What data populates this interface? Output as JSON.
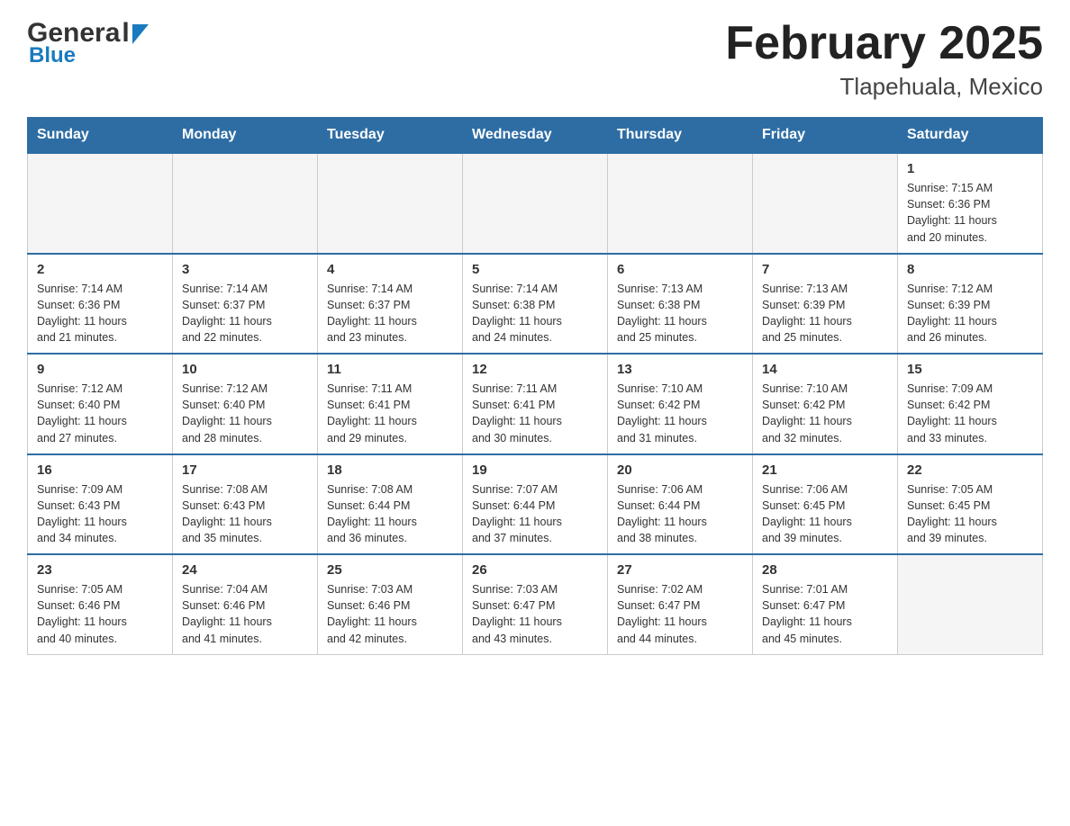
{
  "header": {
    "logo_general": "Genera",
    "logo_l": "l",
    "logo_blue": "Blue",
    "title": "February 2025",
    "subtitle": "Tlapehuala, Mexico"
  },
  "calendar": {
    "days_of_week": [
      "Sunday",
      "Monday",
      "Tuesday",
      "Wednesday",
      "Thursday",
      "Friday",
      "Saturday"
    ],
    "weeks": [
      [
        {
          "day": "",
          "info": ""
        },
        {
          "day": "",
          "info": ""
        },
        {
          "day": "",
          "info": ""
        },
        {
          "day": "",
          "info": ""
        },
        {
          "day": "",
          "info": ""
        },
        {
          "day": "",
          "info": ""
        },
        {
          "day": "1",
          "info": "Sunrise: 7:15 AM\nSunset: 6:36 PM\nDaylight: 11 hours\nand 20 minutes."
        }
      ],
      [
        {
          "day": "2",
          "info": "Sunrise: 7:14 AM\nSunset: 6:36 PM\nDaylight: 11 hours\nand 21 minutes."
        },
        {
          "day": "3",
          "info": "Sunrise: 7:14 AM\nSunset: 6:37 PM\nDaylight: 11 hours\nand 22 minutes."
        },
        {
          "day": "4",
          "info": "Sunrise: 7:14 AM\nSunset: 6:37 PM\nDaylight: 11 hours\nand 23 minutes."
        },
        {
          "day": "5",
          "info": "Sunrise: 7:14 AM\nSunset: 6:38 PM\nDaylight: 11 hours\nand 24 minutes."
        },
        {
          "day": "6",
          "info": "Sunrise: 7:13 AM\nSunset: 6:38 PM\nDaylight: 11 hours\nand 25 minutes."
        },
        {
          "day": "7",
          "info": "Sunrise: 7:13 AM\nSunset: 6:39 PM\nDaylight: 11 hours\nand 25 minutes."
        },
        {
          "day": "8",
          "info": "Sunrise: 7:12 AM\nSunset: 6:39 PM\nDaylight: 11 hours\nand 26 minutes."
        }
      ],
      [
        {
          "day": "9",
          "info": "Sunrise: 7:12 AM\nSunset: 6:40 PM\nDaylight: 11 hours\nand 27 minutes."
        },
        {
          "day": "10",
          "info": "Sunrise: 7:12 AM\nSunset: 6:40 PM\nDaylight: 11 hours\nand 28 minutes."
        },
        {
          "day": "11",
          "info": "Sunrise: 7:11 AM\nSunset: 6:41 PM\nDaylight: 11 hours\nand 29 minutes."
        },
        {
          "day": "12",
          "info": "Sunrise: 7:11 AM\nSunset: 6:41 PM\nDaylight: 11 hours\nand 30 minutes."
        },
        {
          "day": "13",
          "info": "Sunrise: 7:10 AM\nSunset: 6:42 PM\nDaylight: 11 hours\nand 31 minutes."
        },
        {
          "day": "14",
          "info": "Sunrise: 7:10 AM\nSunset: 6:42 PM\nDaylight: 11 hours\nand 32 minutes."
        },
        {
          "day": "15",
          "info": "Sunrise: 7:09 AM\nSunset: 6:42 PM\nDaylight: 11 hours\nand 33 minutes."
        }
      ],
      [
        {
          "day": "16",
          "info": "Sunrise: 7:09 AM\nSunset: 6:43 PM\nDaylight: 11 hours\nand 34 minutes."
        },
        {
          "day": "17",
          "info": "Sunrise: 7:08 AM\nSunset: 6:43 PM\nDaylight: 11 hours\nand 35 minutes."
        },
        {
          "day": "18",
          "info": "Sunrise: 7:08 AM\nSunset: 6:44 PM\nDaylight: 11 hours\nand 36 minutes."
        },
        {
          "day": "19",
          "info": "Sunrise: 7:07 AM\nSunset: 6:44 PM\nDaylight: 11 hours\nand 37 minutes."
        },
        {
          "day": "20",
          "info": "Sunrise: 7:06 AM\nSunset: 6:44 PM\nDaylight: 11 hours\nand 38 minutes."
        },
        {
          "day": "21",
          "info": "Sunrise: 7:06 AM\nSunset: 6:45 PM\nDaylight: 11 hours\nand 39 minutes."
        },
        {
          "day": "22",
          "info": "Sunrise: 7:05 AM\nSunset: 6:45 PM\nDaylight: 11 hours\nand 39 minutes."
        }
      ],
      [
        {
          "day": "23",
          "info": "Sunrise: 7:05 AM\nSunset: 6:46 PM\nDaylight: 11 hours\nand 40 minutes."
        },
        {
          "day": "24",
          "info": "Sunrise: 7:04 AM\nSunset: 6:46 PM\nDaylight: 11 hours\nand 41 minutes."
        },
        {
          "day": "25",
          "info": "Sunrise: 7:03 AM\nSunset: 6:46 PM\nDaylight: 11 hours\nand 42 minutes."
        },
        {
          "day": "26",
          "info": "Sunrise: 7:03 AM\nSunset: 6:47 PM\nDaylight: 11 hours\nand 43 minutes."
        },
        {
          "day": "27",
          "info": "Sunrise: 7:02 AM\nSunset: 6:47 PM\nDaylight: 11 hours\nand 44 minutes."
        },
        {
          "day": "28",
          "info": "Sunrise: 7:01 AM\nSunset: 6:47 PM\nDaylight: 11 hours\nand 45 minutes."
        },
        {
          "day": "",
          "info": ""
        }
      ]
    ]
  }
}
